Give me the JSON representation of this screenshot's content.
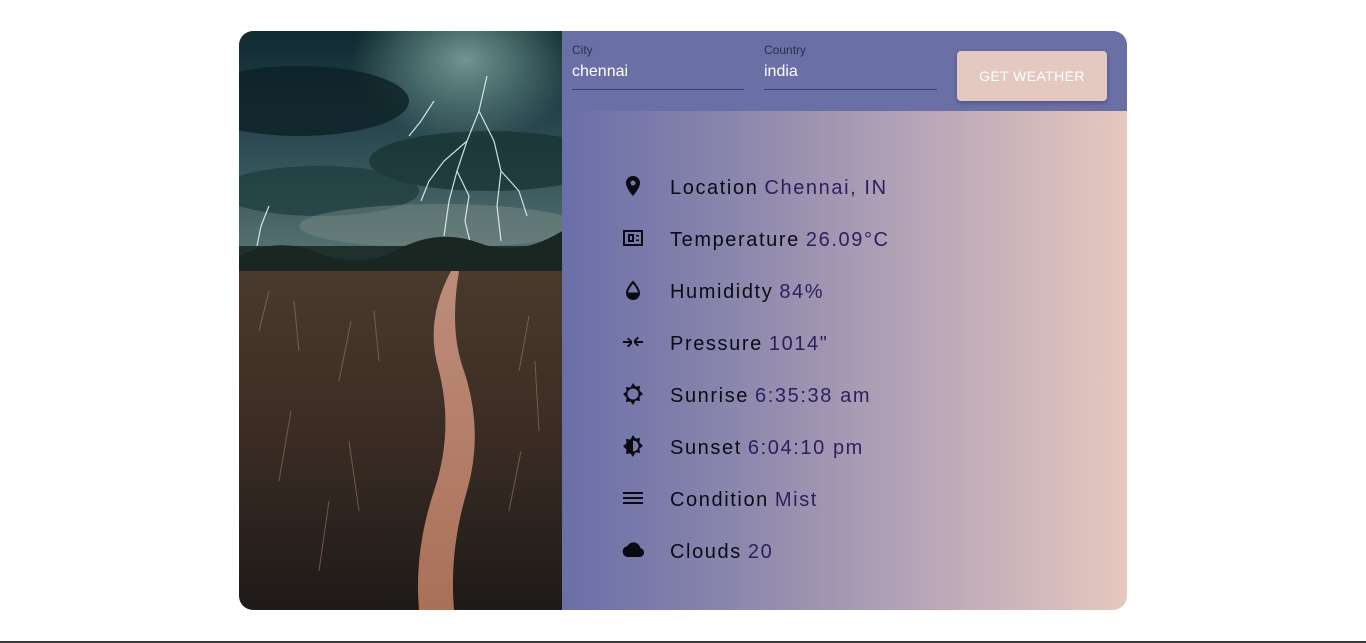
{
  "form": {
    "city_label": "City",
    "city_value": "chennai",
    "country_label": "Country",
    "country_value": "india",
    "button_label": "GET WEATHER"
  },
  "weather": [
    {
      "icon": "location-pin-icon",
      "label": "Location",
      "value": "Chennai, IN"
    },
    {
      "icon": "thermostat-icon",
      "label": "Temperature",
      "value": "26.09°C"
    },
    {
      "icon": "water-drop-icon",
      "label": "Humididty",
      "value": "84%"
    },
    {
      "icon": "compress-arrows-icon",
      "label": "Pressure",
      "value": "1014\""
    },
    {
      "icon": "sun-icon",
      "label": "Sunrise",
      "value": "6:35:38 am"
    },
    {
      "icon": "half-sun-icon",
      "label": "Sunset",
      "value": "6:04:10 pm"
    },
    {
      "icon": "menu-lines-icon",
      "label": "Condition",
      "value": "Mist"
    },
    {
      "icon": "cloud-icon",
      "label": "Clouds",
      "value": "20"
    }
  ],
  "colors": {
    "form_bar": "#6a6fa6",
    "button": "#e3c9c0",
    "gradient_start": "#6a6fa8",
    "gradient_end": "#e6c8be",
    "value_text": "#2b1f5e"
  }
}
